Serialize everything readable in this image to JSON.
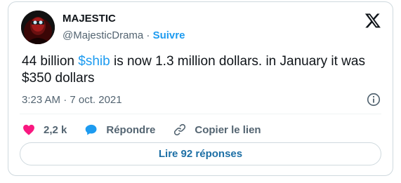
{
  "author": {
    "name": "MAJESTIC",
    "handle": "@MajesticDrama",
    "separator": "·",
    "follow_label": "Suivre"
  },
  "tweet": {
    "text_before": "44 billion ",
    "hashtag": "$shib",
    "text_after": " is now 1.3 million dollars. in January it was $350 dollars"
  },
  "meta": {
    "time": "3:23 AM",
    "separator": "·",
    "date": "7 oct. 2021"
  },
  "actions": {
    "likes": "2,2 k",
    "reply_label": "Répondre",
    "copy_label": "Copier le lien"
  },
  "read_replies_label": "Lire 92 réponses",
  "colors": {
    "accent": "#1d9bf0",
    "like": "#f91880",
    "text": "#0f1419",
    "muted": "#536471",
    "border": "#cfd9de"
  },
  "icons": [
    "x-logo-icon",
    "info-icon",
    "heart-icon",
    "reply-bubble-icon",
    "link-icon"
  ]
}
